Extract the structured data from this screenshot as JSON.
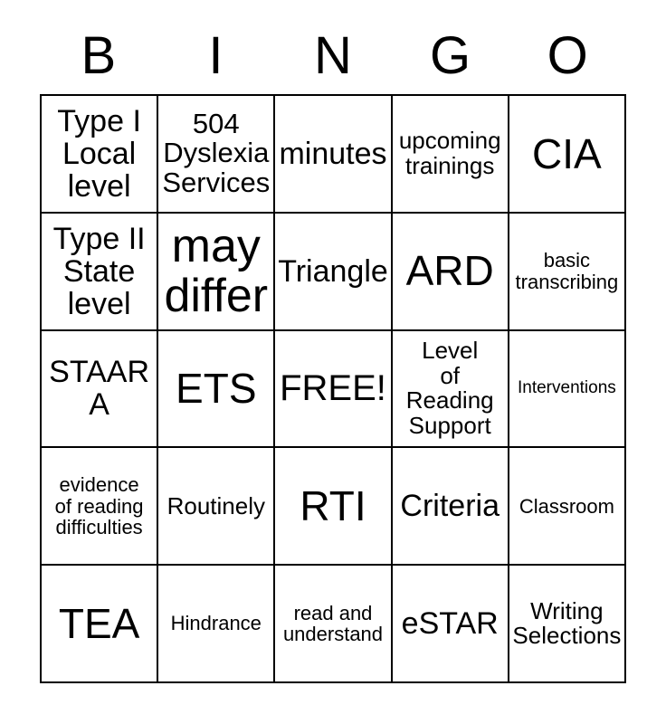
{
  "card": {
    "header_letters": [
      "B",
      "I",
      "N",
      "G",
      "O"
    ],
    "columns": 5,
    "rows": 5,
    "border_color": "#000000",
    "background_color": "#ffffff",
    "text_color": "#000000"
  },
  "cells": [
    {
      "text": "Type I\nLocal\nlevel",
      "size": "fs-m"
    },
    {
      "text": "504\nDyslexia\nServices",
      "size": "fs-s"
    },
    {
      "text": "minutes",
      "size": "fs-m"
    },
    {
      "text": "upcoming\ntrainings",
      "size": "fs-xs"
    },
    {
      "text": "CIA",
      "size": "fs-xl"
    },
    {
      "text": "Type II\nState\nlevel",
      "size": "fs-m"
    },
    {
      "text": "may\ndiffer",
      "size": "fs-xxl"
    },
    {
      "text": "Triangle",
      "size": "fs-m"
    },
    {
      "text": "ARD",
      "size": "fs-xl"
    },
    {
      "text": "basic\ntranscribing",
      "size": "fs-xxs"
    },
    {
      "text": "STAAR\nA",
      "size": "fs-m"
    },
    {
      "text": "ETS",
      "size": "fs-xl"
    },
    {
      "text": "FREE!",
      "size": "fs-l"
    },
    {
      "text": "Level\nof\nReading\nSupport",
      "size": "fs-xs"
    },
    {
      "text": "Interventions",
      "size": "fs-tiny"
    },
    {
      "text": "evidence\nof reading\ndifficulties",
      "size": "fs-xxs"
    },
    {
      "text": "Routinely",
      "size": "fs-xs"
    },
    {
      "text": "RTI",
      "size": "fs-xl"
    },
    {
      "text": "Criteria",
      "size": "fs-m"
    },
    {
      "text": "Classroom",
      "size": "fs-xxs"
    },
    {
      "text": "TEA",
      "size": "fs-xl"
    },
    {
      "text": "Hindrance",
      "size": "fs-xxs"
    },
    {
      "text": "read and\nunderstand",
      "size": "fs-xxs"
    },
    {
      "text": "eSTAR",
      "size": "fs-m"
    },
    {
      "text": "Writing\nSelections",
      "size": "fs-xs"
    }
  ]
}
